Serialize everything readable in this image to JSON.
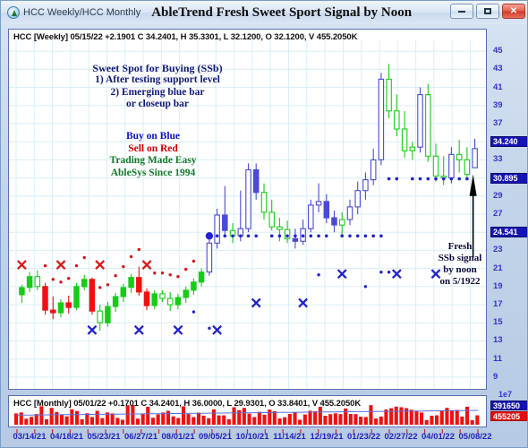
{
  "window": {
    "doc_title": "HCC Weekly/HCC Monthly",
    "main_title": "AbleTrend Fresh Sweet Sport Signal by Noon",
    "app_icon": "ablesys-globe-icon",
    "minimize_label": "–",
    "maximize_label": "□",
    "close_label": "✕"
  },
  "price_panel": {
    "ohlc_line": "HCC [Weekly] 05/15/22  +2.1901 C 34.2401, H 35.3301, L 32.1200, O 32.1200, V 455.2050K"
  },
  "volume_panel": {
    "ohlc_line": "HCC [Monthly] 05/01/22  +0.1701 C 34.2401, H 36.0000, L 29.9301, O 33.8401, V 455.2050K"
  },
  "annotations": {
    "ssb": {
      "line1": "Sweet Spot for Buying (SSb)",
      "line2": "1) After testing support level",
      "line3": "2) Emerging blue bar",
      "line4": "or closeup bar",
      "color": "#10197a"
    },
    "legend": {
      "buy": "Buy on Blue",
      "sell": "Sell on Red",
      "tagline1": "Trading Made Easy",
      "tagline2": "AbleSys Since 1994",
      "buy_color": "#0b10c8",
      "sell_color": "#d00000",
      "tagline_color": "#0f7a2a"
    },
    "fresh_signal": {
      "line1": "Fresh",
      "line2": "SSb signal",
      "line3": "by noon",
      "line4": "on 5/1922",
      "color": "#0a0a3c",
      "arrow": "up-arrow-pointer"
    }
  },
  "price_axis": {
    "ticks": [
      "45",
      "43",
      "41",
      "39",
      "37",
      "35",
      "33",
      "31",
      "29",
      "27",
      "25",
      "23",
      "21",
      "19",
      "17",
      "15",
      "13",
      "11",
      "9"
    ],
    "highlight_boxes": [
      {
        "value": "34.240",
        "color": "#1414b4"
      },
      {
        "value": "30.895",
        "color": "#1414b4"
      },
      {
        "value": "24.541",
        "color": "#1414b4"
      }
    ],
    "tick_color": "#3333cc"
  },
  "volume_axis": {
    "exponent_label": "1e7",
    "boxes": [
      {
        "value": "391650",
        "color": "#1414b4"
      },
      {
        "value": "455205",
        "color": "#e01010"
      }
    ]
  },
  "date_axis": {
    "labels": [
      "03/14/21",
      "04/18/21",
      "05/23/21",
      "06/27/21",
      "08/01/21",
      "09/05/21",
      "10/10/21",
      "11/14/21",
      "12/19/21",
      "01/23/22",
      "02/27/22",
      "04/01/22",
      "05/08/22"
    ],
    "color": "#2222bb"
  },
  "chart_data": {
    "type": "candlestick",
    "title": "AbleTrend Fresh Sweet Sport Signal by Noon",
    "symbol": "HCC",
    "interval": "Weekly",
    "xlabel": "",
    "ylabel": "",
    "ylim": [
      8,
      46
    ],
    "yticks": [
      45,
      43,
      41,
      39,
      37,
      35,
      33,
      31,
      29,
      27,
      25,
      23,
      21,
      19,
      17,
      15,
      13,
      11,
      9
    ],
    "grid": true,
    "colors": {
      "up_blue": "#4a4ad4",
      "up_green": "#17cc17",
      "down_red": "#ee1111",
      "stop_red": "#d81818",
      "stop_blue": "#2222cc",
      "grid": "#d8eef5"
    },
    "last_close": 34.2401,
    "last_high": 35.3301,
    "last_low": 32.12,
    "last_open": 32.12,
    "last_volume_k": 455.205,
    "bars": [
      {
        "o": 18.1,
        "h": 19.2,
        "l": 17.2,
        "c": 18.9,
        "color": "green"
      },
      {
        "o": 18.9,
        "h": 20.6,
        "l": 18.4,
        "c": 20.1,
        "color": "green"
      },
      {
        "o": 20.1,
        "h": 20.8,
        "l": 18.6,
        "c": 19.0,
        "color": "green"
      },
      {
        "o": 19.0,
        "h": 19.4,
        "l": 15.9,
        "c": 16.4,
        "color": "red"
      },
      {
        "o": 16.4,
        "h": 17.9,
        "l": 15.4,
        "c": 16.1,
        "color": "red"
      },
      {
        "o": 16.1,
        "h": 17.6,
        "l": 15.6,
        "c": 17.2,
        "color": "green"
      },
      {
        "o": 17.2,
        "h": 18.0,
        "l": 16.0,
        "c": 16.7,
        "color": "red"
      },
      {
        "o": 16.7,
        "h": 19.4,
        "l": 16.4,
        "c": 19.0,
        "color": "green"
      },
      {
        "o": 19.0,
        "h": 20.3,
        "l": 18.6,
        "c": 19.8,
        "color": "green"
      },
      {
        "o": 19.8,
        "h": 20.0,
        "l": 15.9,
        "c": 16.3,
        "color": "red"
      },
      {
        "o": 16.3,
        "h": 17.0,
        "l": 14.1,
        "c": 15.0,
        "color": "green"
      },
      {
        "o": 15.0,
        "h": 17.3,
        "l": 14.6,
        "c": 16.8,
        "color": "green"
      },
      {
        "o": 16.8,
        "h": 18.3,
        "l": 16.2,
        "c": 17.9,
        "color": "green"
      },
      {
        "o": 17.9,
        "h": 19.3,
        "l": 17.3,
        "c": 18.9,
        "color": "green"
      },
      {
        "o": 18.9,
        "h": 20.4,
        "l": 18.3,
        "c": 20.0,
        "color": "green"
      },
      {
        "o": 20.0,
        "h": 21.2,
        "l": 18.0,
        "c": 18.4,
        "color": "red"
      },
      {
        "o": 18.4,
        "h": 18.8,
        "l": 16.4,
        "c": 16.9,
        "color": "red"
      },
      {
        "o": 16.9,
        "h": 18.6,
        "l": 16.5,
        "c": 18.2,
        "color": "green"
      },
      {
        "o": 18.2,
        "h": 18.6,
        "l": 17.3,
        "c": 17.7,
        "color": "green"
      },
      {
        "o": 17.7,
        "h": 18.4,
        "l": 16.3,
        "c": 17.0,
        "color": "green"
      },
      {
        "o": 17.0,
        "h": 18.2,
        "l": 16.5,
        "c": 17.8,
        "color": "green"
      },
      {
        "o": 17.8,
        "h": 19.0,
        "l": 17.2,
        "c": 18.6,
        "color": "green"
      },
      {
        "o": 18.6,
        "h": 19.9,
        "l": 18.1,
        "c": 19.5,
        "color": "green"
      },
      {
        "o": 19.5,
        "h": 21.0,
        "l": 19.0,
        "c": 20.6,
        "color": "green"
      },
      {
        "o": 20.6,
        "h": 24.2,
        "l": 20.2,
        "c": 23.8,
        "color": "blue"
      },
      {
        "o": 23.8,
        "h": 27.6,
        "l": 23.2,
        "c": 26.9,
        "color": "blue"
      },
      {
        "o": 26.9,
        "h": 30.1,
        "l": 24.6,
        "c": 25.2,
        "color": "blue"
      },
      {
        "o": 25.2,
        "h": 26.0,
        "l": 23.8,
        "c": 24.6,
        "color": "green"
      },
      {
        "o": 24.6,
        "h": 29.6,
        "l": 24.0,
        "c": 25.4,
        "color": "blue"
      },
      {
        "o": 25.4,
        "h": 32.6,
        "l": 25.0,
        "c": 31.9,
        "color": "blue"
      },
      {
        "o": 31.9,
        "h": 32.6,
        "l": 28.6,
        "c": 29.4,
        "color": "blue"
      },
      {
        "o": 29.4,
        "h": 30.4,
        "l": 26.4,
        "c": 27.2,
        "color": "green"
      },
      {
        "o": 27.2,
        "h": 28.6,
        "l": 25.2,
        "c": 25.6,
        "color": "green"
      },
      {
        "o": 25.6,
        "h": 26.6,
        "l": 24.0,
        "c": 25.3,
        "color": "green"
      },
      {
        "o": 25.3,
        "h": 26.3,
        "l": 23.8,
        "c": 24.3,
        "color": "green"
      },
      {
        "o": 24.3,
        "h": 25.4,
        "l": 23.2,
        "c": 24.0,
        "color": "blue"
      },
      {
        "o": 24.0,
        "h": 26.4,
        "l": 23.6,
        "c": 25.4,
        "color": "blue"
      },
      {
        "o": 25.4,
        "h": 28.6,
        "l": 25.0,
        "c": 28.0,
        "color": "blue"
      },
      {
        "o": 28.0,
        "h": 30.4,
        "l": 27.2,
        "c": 28.4,
        "color": "blue"
      },
      {
        "o": 28.4,
        "h": 29.2,
        "l": 26.0,
        "c": 26.6,
        "color": "blue"
      },
      {
        "o": 26.6,
        "h": 27.4,
        "l": 25.0,
        "c": 25.8,
        "color": "blue"
      },
      {
        "o": 25.8,
        "h": 27.2,
        "l": 24.6,
        "c": 26.4,
        "color": "green"
      },
      {
        "o": 26.4,
        "h": 28.6,
        "l": 25.8,
        "c": 27.8,
        "color": "blue"
      },
      {
        "o": 27.8,
        "h": 30.6,
        "l": 27.0,
        "c": 29.6,
        "color": "blue"
      },
      {
        "o": 29.6,
        "h": 31.6,
        "l": 28.6,
        "c": 30.8,
        "color": "blue"
      },
      {
        "o": 30.8,
        "h": 34.2,
        "l": 30.2,
        "c": 33.0,
        "color": "blue"
      },
      {
        "o": 33.0,
        "h": 42.6,
        "l": 32.4,
        "c": 41.9,
        "color": "blue"
      },
      {
        "o": 41.9,
        "h": 43.6,
        "l": 37.6,
        "c": 38.4,
        "color": "green"
      },
      {
        "o": 38.4,
        "h": 40.2,
        "l": 35.6,
        "c": 36.4,
        "color": "green"
      },
      {
        "o": 36.4,
        "h": 38.4,
        "l": 33.2,
        "c": 34.0,
        "color": "green"
      },
      {
        "o": 34.0,
        "h": 35.0,
        "l": 33.0,
        "c": 34.4,
        "color": "green"
      },
      {
        "o": 34.4,
        "h": 41.0,
        "l": 33.8,
        "c": 40.2,
        "color": "blue"
      },
      {
        "o": 40.2,
        "h": 41.4,
        "l": 32.8,
        "c": 33.4,
        "color": "green"
      },
      {
        "o": 33.4,
        "h": 34.8,
        "l": 30.6,
        "c": 31.2,
        "color": "green"
      },
      {
        "o": 31.2,
        "h": 33.4,
        "l": 30.2,
        "c": 31.0,
        "color": "green"
      },
      {
        "o": 31.0,
        "h": 34.4,
        "l": 30.4,
        "c": 33.6,
        "color": "blue"
      },
      {
        "o": 33.6,
        "h": 35.2,
        "l": 31.6,
        "c": 33.0,
        "color": "green"
      },
      {
        "o": 33.0,
        "h": 34.4,
        "l": 30.8,
        "c": 31.4,
        "color": "green"
      },
      {
        "o": 32.12,
        "h": 35.33,
        "l": 32.12,
        "c": 34.24,
        "color": "blue"
      }
    ],
    "signals": {
      "stop_dots_red_above": "red dotted stop line above bars (downtrend, bars 3-24)",
      "stop_dots_blue_below": "blue dotted stop line below bars (uptrend, bars 25-59)",
      "red_x_markers": 4,
      "blue_x_markers": 9,
      "big_blue_dot_index": 24
    },
    "volume_series_label": "HCC Monthly volume histogram",
    "volume_color": "#ee1111"
  }
}
